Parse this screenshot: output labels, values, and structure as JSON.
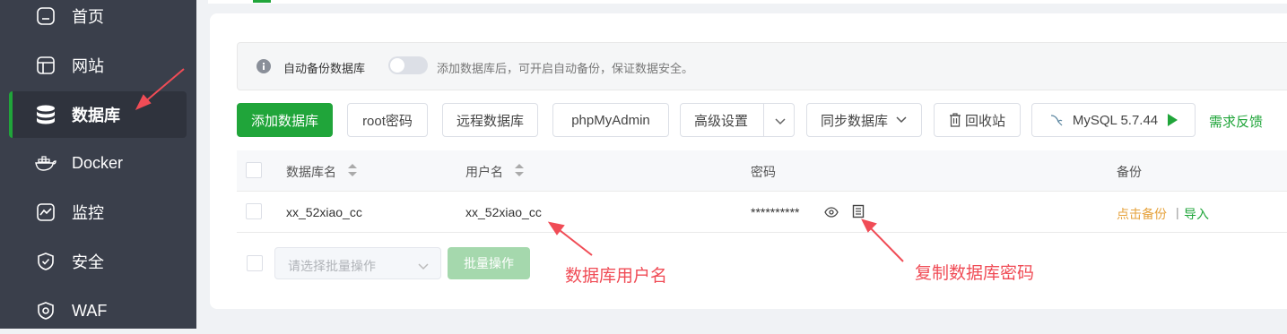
{
  "sidebar": {
    "items": [
      {
        "label": "首页",
        "icon": "home-icon"
      },
      {
        "label": "网站",
        "icon": "website-icon"
      },
      {
        "label": "数据库",
        "icon": "database-icon",
        "active": true
      },
      {
        "label": "Docker",
        "icon": "docker-icon"
      },
      {
        "label": "监控",
        "icon": "monitor-icon"
      },
      {
        "label": "安全",
        "icon": "shield-icon"
      },
      {
        "label": "WAF",
        "icon": "waf-icon"
      }
    ]
  },
  "notice": {
    "label": "自动备份数据库",
    "hint": "添加数据库后，可开启自动备份，保证数据安全。",
    "toggle_on": false
  },
  "toolbar": {
    "add_db": "添加数据库",
    "root_password": "root密码",
    "remote_db": "远程数据库",
    "phpmyadmin": "phpMyAdmin",
    "advanced": "高级设置",
    "sync_db": "同步数据库",
    "recycle_bin": "回收站",
    "mysql_version": "MySQL 5.7.44",
    "feedback": "需求反馈"
  },
  "table": {
    "headers": {
      "name": "数据库名",
      "user": "用户名",
      "password": "密码",
      "backup": "备份"
    },
    "rows": [
      {
        "name": "xx_52xiao_cc",
        "user": "xx_52xiao_cc",
        "password": "**********",
        "backup": "点击备份",
        "import": "导入",
        "sep": "|"
      }
    ]
  },
  "batch": {
    "placeholder": "请选择批量操作",
    "button": "批量操作"
  },
  "annotations": {
    "username": "数据库用户名",
    "copy_password": "复制数据库密码"
  },
  "colors": {
    "accent": "#20a53a",
    "sidebar_bg": "#3a3f4b",
    "annotation": "#f04c56",
    "backup_link": "#e6a23c"
  }
}
